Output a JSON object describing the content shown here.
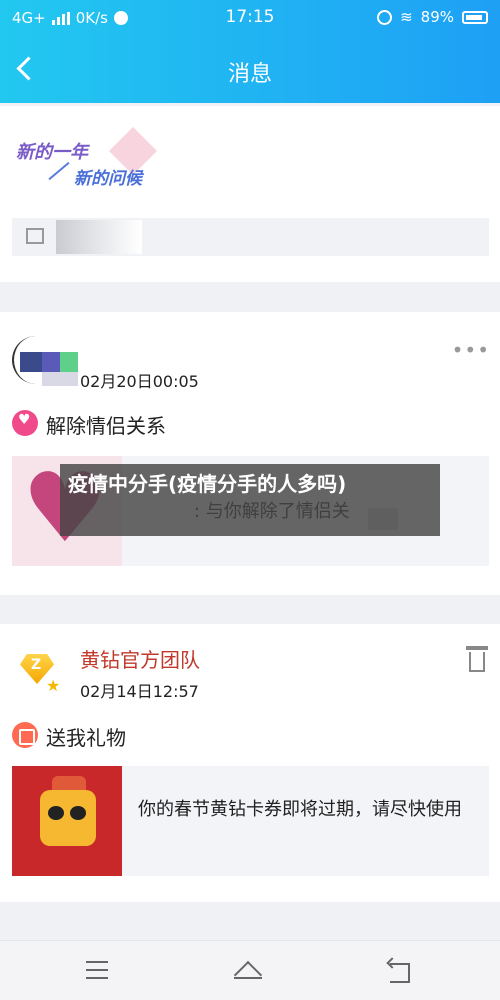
{
  "status_bar": {
    "network": "4G+",
    "speed": "0K/s",
    "time": "17:15",
    "battery": "89%"
  },
  "header": {
    "title": "消息"
  },
  "banner": {
    "line1": "新的一年",
    "line2": "新的问候"
  },
  "messages": [
    {
      "date": "02月20日00:05",
      "action": "解除情侣关系",
      "content": ": 与你解除了情侣关"
    },
    {
      "sender": "黄钻官方团队",
      "date": "02月14日12:57",
      "action": "送我礼物",
      "content": "你的春节黄钻卡券即将过期，请尽快使用"
    }
  ],
  "overlay": {
    "title": "疫情中分手(疫情分手的人多吗)"
  },
  "colors": {
    "header_start": "#22c8f0",
    "header_end": "#1ea0f5",
    "team_name": "#c0392b",
    "heart_icon": "#f04a8a",
    "gift_icon": "#ff6a52"
  }
}
